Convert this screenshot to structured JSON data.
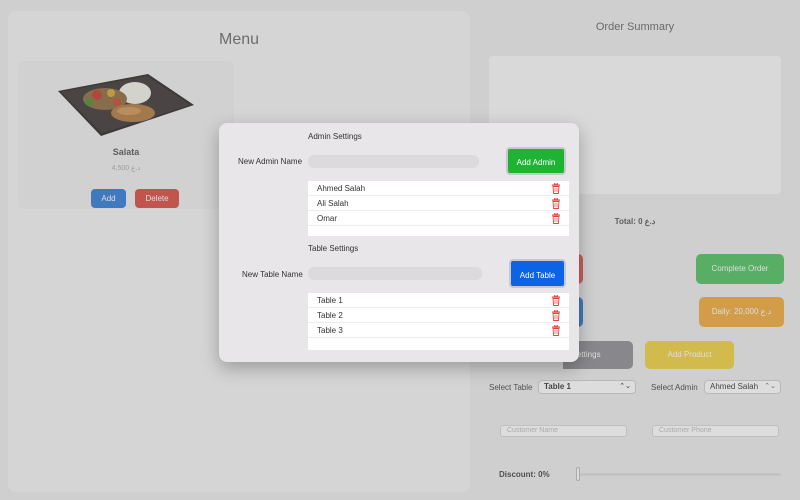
{
  "menu": {
    "title": "Menu",
    "product": {
      "name": "Salata",
      "price": "4,500 د.ع",
      "add_label": "Add",
      "delete_label": "Delete"
    }
  },
  "order": {
    "title": "Order Summary",
    "total": "Total: 0 د.ع",
    "complete_label": "Complete Order",
    "daily_label": "Daily: 20,000 د.ع",
    "settings_label": "ettings",
    "add_product_label": "Add Product",
    "select_table_label": "Select Table",
    "select_table_value": "Table 1",
    "select_admin_label": "Select Admin",
    "select_admin_value": "Ahmed Salah",
    "customer_name_placeholder": "Customer Name",
    "customer_phone_placeholder": "Customer Phone",
    "discount_label": "Discount: 0%",
    "discount_value": 0
  },
  "modal": {
    "admin_section_title": "Admin Settings",
    "new_admin_label": "New Admin Name",
    "new_admin_value": "",
    "add_admin_label": "Add Admin",
    "admins": [
      "Ahmed Salah",
      "Ali Salah",
      "Omar"
    ],
    "table_section_title": "Table Settings",
    "new_table_label": "New Table Name",
    "new_table_value": "",
    "add_table_label": "Add Table",
    "tables": [
      "Table 1",
      "Table 2",
      "Table 3"
    ]
  },
  "icons": {
    "trash": "trash-icon",
    "chevron": "chevron-updown-icon"
  },
  "colors": {
    "green": "#1fb335",
    "blue": "#0b63e5",
    "red_icon": "#e0443a"
  }
}
